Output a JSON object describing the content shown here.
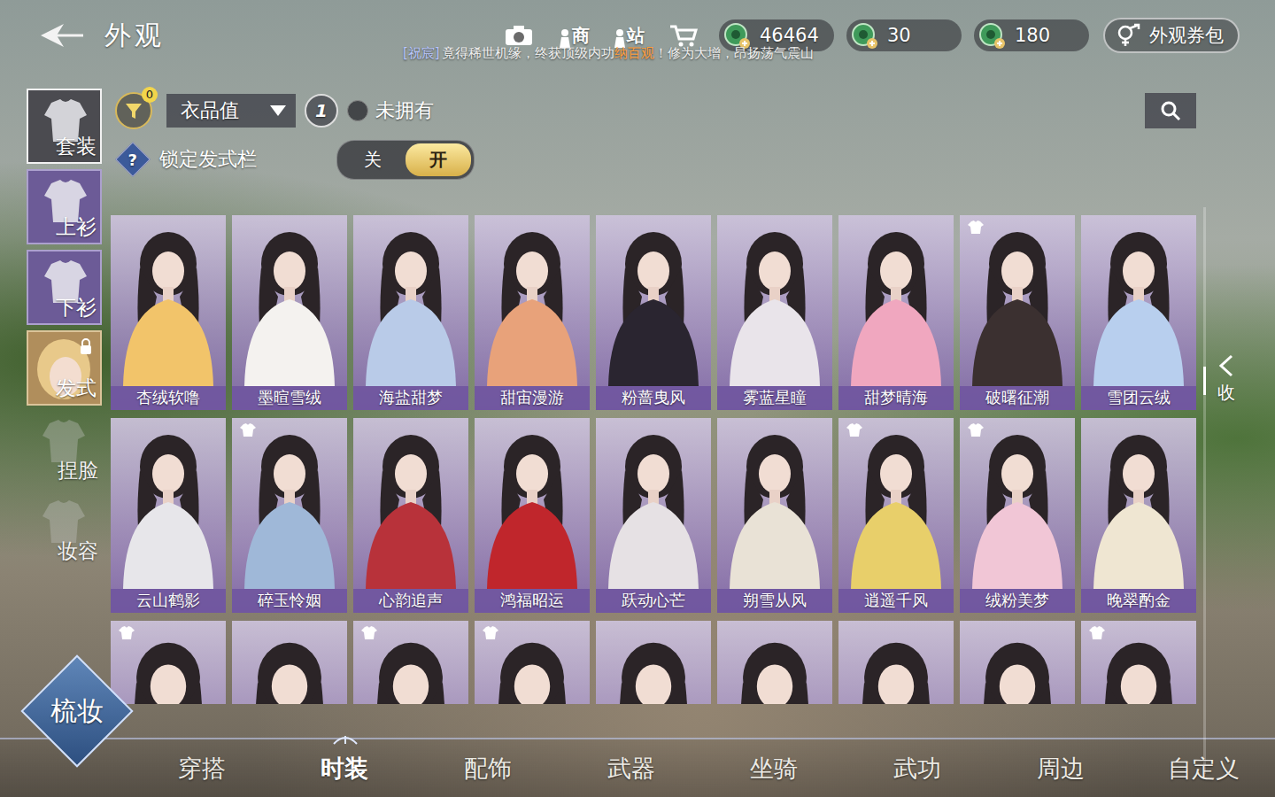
{
  "header": {
    "title": "外观"
  },
  "tools": [
    {
      "kind": "camera"
    },
    {
      "kind": "shop",
      "label": "商"
    },
    {
      "kind": "station",
      "label": "站"
    },
    {
      "kind": "cart"
    }
  ],
  "currencies": [
    {
      "amount": "46464"
    },
    {
      "amount": "30"
    },
    {
      "amount": "180"
    }
  ],
  "voucher_button": "外观券包",
  "broadcast": {
    "tag": "[祝宸]",
    "before": "竟得稀世机缘，终获顶级内功",
    "highlight": "纳百观",
    "after": "！修为大增，昂扬荡气震山"
  },
  "sidebar": [
    {
      "label": "套装",
      "kind": "tile",
      "selected": true,
      "locked": false
    },
    {
      "label": "上衫",
      "kind": "tile",
      "selected": false,
      "locked": false
    },
    {
      "label": "下衫",
      "kind": "tile",
      "selected": false,
      "locked": false
    },
    {
      "label": "发式",
      "kind": "face",
      "selected": false,
      "locked": true
    },
    {
      "label": "捏脸",
      "kind": "plain",
      "selected": false,
      "locked": false
    },
    {
      "label": "妆容",
      "kind": "plain",
      "selected": false,
      "locked": false
    }
  ],
  "filters": {
    "badge": "0",
    "sort_label": "衣品值",
    "order": "1",
    "unowned": {
      "label": "未拥有",
      "checked": false
    }
  },
  "lock_hair": {
    "help": "?",
    "label": "锁定发式栏",
    "options": [
      {
        "label": "关",
        "selected": false
      },
      {
        "label": "开",
        "selected": true
      }
    ]
  },
  "collapse": "收",
  "grid": [
    {
      "name": "杏绒软噜",
      "badge": false,
      "color": "#f2c46a"
    },
    {
      "name": "墨暄雪绒",
      "badge": false,
      "color": "#f4f2ef"
    },
    {
      "name": "海盐甜梦",
      "badge": false,
      "color": "#b9cbe8"
    },
    {
      "name": "甜宙漫游",
      "badge": false,
      "color": "#e8a27a"
    },
    {
      "name": "粉蔷曳风",
      "badge": false,
      "color": "#2a2530"
    },
    {
      "name": "雾蓝星瞳",
      "badge": false,
      "color": "#e9e4ea"
    },
    {
      "name": "甜梦晴海",
      "badge": false,
      "color": "#f0a7bf"
    },
    {
      "name": "破曙征潮",
      "badge": true,
      "color": "#3b3030"
    },
    {
      "name": "雪团云绒",
      "badge": false,
      "color": "#b8cfee"
    },
    {
      "name": "云山鹤影",
      "badge": false,
      "color": "#e7e6ea"
    },
    {
      "name": "碎玉怜姻",
      "badge": true,
      "color": "#9fb8d8"
    },
    {
      "name": "心韵追声",
      "badge": false,
      "color": "#b8323a"
    },
    {
      "name": "鸿福昭运",
      "badge": false,
      "color": "#c0262c"
    },
    {
      "name": "跃动心芒",
      "badge": false,
      "color": "#e6e1e4"
    },
    {
      "name": "朔雪从风",
      "badge": false,
      "color": "#e9e2d6"
    },
    {
      "name": "逍遥千风",
      "badge": true,
      "color": "#e8cf6a"
    },
    {
      "name": "绒粉美梦",
      "badge": true,
      "color": "#f1c6d6"
    },
    {
      "name": "晚翠酌金",
      "badge": false,
      "color": "#efe6d2"
    },
    {
      "badge": true,
      "color": "#f3d7df"
    },
    {
      "badge": false,
      "color": "#d9d2de"
    },
    {
      "badge": true,
      "color": "#c9c0d4"
    },
    {
      "badge": true,
      "color": "#8b6b52"
    },
    {
      "badge": false,
      "color": "#e4e0e6"
    },
    {
      "badge": false,
      "color": "#d8ccc4"
    },
    {
      "badge": false,
      "color": "#cfc6cc"
    },
    {
      "badge": false,
      "color": "#e4d6a0"
    },
    {
      "badge": true,
      "color": "#d9c9c2"
    }
  ],
  "dress_button": "梳妆",
  "nav": [
    {
      "label": "穿搭",
      "selected": false
    },
    {
      "label": "时装",
      "selected": true
    },
    {
      "label": "配饰",
      "selected": false
    },
    {
      "label": "武器",
      "selected": false
    },
    {
      "label": "坐骑",
      "selected": false
    },
    {
      "label": "武功",
      "selected": false
    },
    {
      "label": "周边",
      "selected": false
    },
    {
      "label": "自定义",
      "selected": false
    }
  ]
}
